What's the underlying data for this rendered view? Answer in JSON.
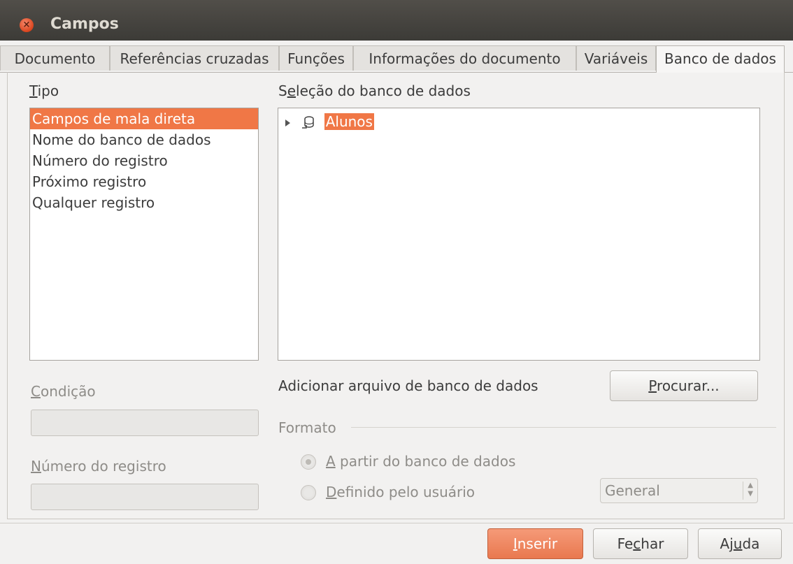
{
  "window": {
    "title": "Campos"
  },
  "tabs": [
    {
      "label": "Documento"
    },
    {
      "label": "Referências cruzadas"
    },
    {
      "label": "Funções"
    },
    {
      "label": "Informações do documento"
    },
    {
      "label": "Variáveis"
    },
    {
      "label": "Banco de dados",
      "active": true
    }
  ],
  "tipo": {
    "label_pre": "",
    "label_u": "T",
    "label_post": "ipo",
    "items": [
      "Campos de mala direta",
      "Nome do banco de dados",
      "Número do registro",
      "Próximo registro",
      "Qualquer registro"
    ],
    "selected_index": 0
  },
  "selecao": {
    "label_pre": "S",
    "label_u": "e",
    "label_post": "leção do banco de dados",
    "tree_item": "Alunos"
  },
  "condicao": {
    "label_u": "C",
    "label_post": "ondição"
  },
  "numero_registro": {
    "label_u": "N",
    "label_post": "úmero do registro"
  },
  "adicionar": {
    "label": "Adicionar arquivo de banco de dados",
    "button_u": "P",
    "button_post": "rocurar..."
  },
  "formato": {
    "label": "Formato",
    "radio1_u": "A",
    "radio1_post": " partir do banco de dados",
    "radio2_u": "D",
    "radio2_post": "efinido pelo usuário",
    "combo_value": "General"
  },
  "buttons": {
    "inserir_u": "I",
    "inserir_post": "nserir",
    "fechar_pre": "Fe",
    "fechar_u": "c",
    "fechar_post": "har",
    "ajuda_pre": "Aj",
    "ajuda_u": "u",
    "ajuda_post": "da"
  },
  "colors": {
    "accent": "#f07746",
    "titlebar": "#3c3b37"
  }
}
